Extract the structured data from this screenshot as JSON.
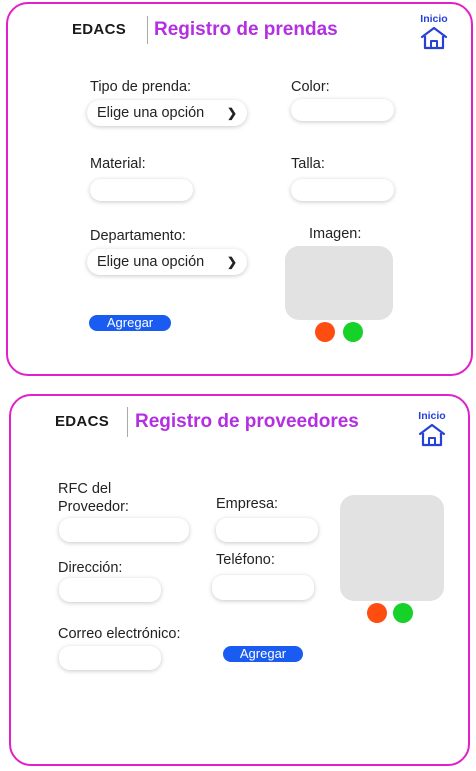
{
  "prendas": {
    "brand": "EDACS",
    "title": "Registro de prendas",
    "home_label": "Inicio",
    "tipo_label": "Tipo de prenda:",
    "tipo_value": "Elige una opción",
    "color_label": "Color:",
    "color_value": "",
    "material_label": "Material:",
    "material_value": "",
    "talla_label": "Talla:",
    "talla_value": "",
    "departamento_label": "Departamento:",
    "departamento_value": "Elige una opción",
    "imagen_label": "Imagen:",
    "add_button": "Agregar"
  },
  "proveedores": {
    "brand": "EDACS",
    "title": "Registro de proveedores",
    "home_label": "Inicio",
    "rfc_label_1": "RFC del",
    "rfc_label_2": "Proveedor:",
    "rfc_value": "",
    "empresa_label": "Empresa:",
    "empresa_value": "",
    "direccion_label": "Dirección:",
    "direccion_value": "",
    "telefono_label": "Teléfono:",
    "telefono_value": "",
    "correo_label": "Correo electrónico:",
    "correo_value": "",
    "add_button": "Agregar"
  },
  "icons": {
    "home": "home-icon",
    "chevron": "chevron-down-icon"
  },
  "colors": {
    "panel_border": "#e020c8",
    "title": "#b32fe0",
    "home_link": "#2740d6",
    "button": "#1a5cf2",
    "image_placeholder": "#e2e2e2",
    "delete_dot": "#ff4d12",
    "confirm_dot": "#16d127"
  }
}
